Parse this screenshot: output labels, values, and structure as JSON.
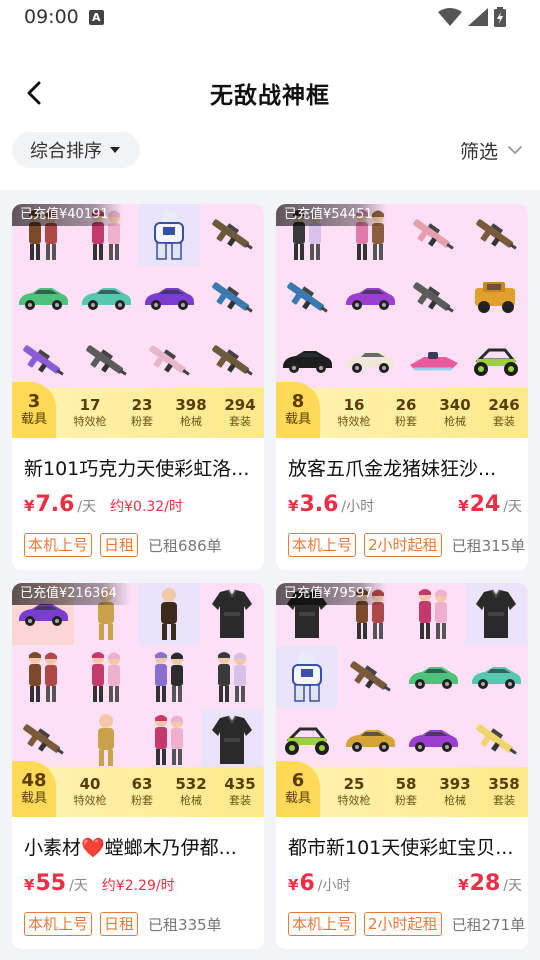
{
  "status_bar": {
    "time": "09:00",
    "a_icon": "A"
  },
  "nav": {
    "title": "无敌战神框"
  },
  "filter": {
    "sort_label": "综合排序",
    "filter_label": "筛选"
  },
  "cards": [
    {
      "recharge": "已充值¥40191",
      "vehicles": {
        "num": "3",
        "label": "载具"
      },
      "stats": [
        {
          "num": "17",
          "label": "特效枪"
        },
        {
          "num": "23",
          "label": "粉套"
        },
        {
          "num": "398",
          "label": "枪械"
        },
        {
          "num": "294",
          "label": "套装"
        }
      ],
      "title": "新101巧克力天使彩虹洛...",
      "price": {
        "yen": "¥",
        "amount": "7.6",
        "unit": "/天",
        "per_hour": "约¥0.32/时"
      },
      "price_right": null,
      "tags": [
        "本机上号",
        "日租"
      ],
      "rented": "已租686单"
    },
    {
      "recharge": "已充值¥54451",
      "vehicles": {
        "num": "8",
        "label": "载具"
      },
      "stats": [
        {
          "num": "16",
          "label": "特效枪"
        },
        {
          "num": "26",
          "label": "粉套"
        },
        {
          "num": "340",
          "label": "枪械"
        },
        {
          "num": "246",
          "label": "套装"
        }
      ],
      "title": "放客五爪金龙猪妹狂沙...",
      "price": {
        "yen": "¥",
        "amount": "3.6",
        "unit": "/小时",
        "per_hour": ""
      },
      "price_right": {
        "yen": "¥",
        "amount": "24",
        "unit": "/天"
      },
      "tags": [
        "本机上号",
        "2小时起租"
      ],
      "rented": "已租315单"
    },
    {
      "recharge": "已充值¥216364",
      "vehicles": {
        "num": "48",
        "label": "载具"
      },
      "stats": [
        {
          "num": "40",
          "label": "特效枪"
        },
        {
          "num": "63",
          "label": "粉套"
        },
        {
          "num": "532",
          "label": "枪械"
        },
        {
          "num": "435",
          "label": "套装"
        }
      ],
      "title": "小素材❤️螳螂木乃伊都...",
      "price": {
        "yen": "¥",
        "amount": "55",
        "unit": "/天",
        "per_hour": "约¥2.29/时"
      },
      "price_right": null,
      "tags": [
        "本机上号",
        "日租"
      ],
      "rented": "已租335单"
    },
    {
      "recharge": "已充值¥79597",
      "vehicles": {
        "num": "6",
        "label": "载具"
      },
      "stats": [
        {
          "num": "25",
          "label": "特效枪"
        },
        {
          "num": "58",
          "label": "粉套"
        },
        {
          "num": "393",
          "label": "枪械"
        },
        {
          "num": "358",
          "label": "套装"
        }
      ],
      "title": "都市新101天使彩虹宝贝...",
      "price": {
        "yen": "¥",
        "amount": "6",
        "unit": "/小时",
        "per_hour": ""
      },
      "price_right": {
        "yen": "¥",
        "amount": "28",
        "unit": "/天"
      },
      "tags": [
        "本机上号",
        "2小时起租"
      ],
      "rented": "已租271单"
    }
  ],
  "thumb_items": [
    [
      "character-duo-icon",
      "character-duo-icon",
      "mecha-suit-icon",
      "rifle-icon",
      "sports-car-icon",
      "sports-car-icon",
      "sports-car-icon",
      "rifle-icon",
      "rifle-icon",
      "rifle-icon",
      "rifle-icon",
      "rifle-icon"
    ],
    [
      "character-duo-icon",
      "character-duo-icon",
      "rifle-icon",
      "rifle-icon",
      "rifle-icon",
      "sports-car-icon",
      "rifle-icon",
      "jeep-icon",
      "sports-car-icon",
      "sports-car-icon",
      "jet-ski-icon",
      "buggy-icon"
    ],
    [
      "sports-car-icon",
      "character-icon",
      "character-icon",
      "outfit-icon",
      "character-duo-icon",
      "character-duo-icon",
      "character-duo-icon",
      "character-duo-icon",
      "rifle-icon",
      "character-icon",
      "character-duo-icon",
      "outfit-icon"
    ],
    [
      "outfit-icon",
      "character-duo-icon",
      "character-duo-icon",
      "outfit-icon",
      "mecha-suit-icon",
      "rifle-icon",
      "sports-car-icon",
      "sports-car-icon",
      "buggy-icon",
      "sports-car-icon",
      "sports-car-icon",
      "rifle-icon"
    ]
  ],
  "colors": {
    "price_red": "#f02d42",
    "tag_orange": "#e8793a",
    "stats_yellow": "#fde98a",
    "thumb_pink": "#fde0f6"
  }
}
